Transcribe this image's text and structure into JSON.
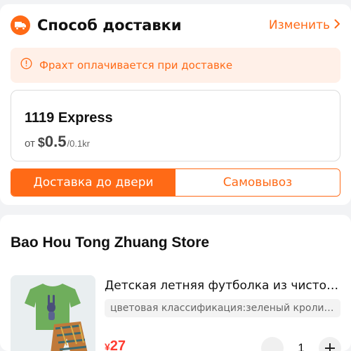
{
  "delivery": {
    "title": "Способ доставки",
    "change_label": "Изменить",
    "freight_notice": "Фрахт оплачивается при доставке",
    "shipping_option": {
      "carrier": "1119 Express",
      "price_prefix": "от",
      "currency": "$",
      "amount": "0.5",
      "unit": "/0.1kr"
    },
    "tabs": [
      {
        "label": "Доставка до двери",
        "active": true
      },
      {
        "label": "Самовывоз",
        "active": false
      }
    ]
  },
  "store": {
    "name": "Bao Hou Tong Zhuang Store",
    "product": {
      "title": "Детская летняя футболка из чистог...",
      "variant": "цветовая классификация:зеленый кролик...",
      "price_prefix": "¥",
      "price": "27",
      "quantity": "1"
    }
  },
  "icons": {
    "delivery": "truck-icon",
    "change": "chevron-right-icon",
    "notice": "info-circle-icon",
    "minus": "minus-icon",
    "plus": "plus-icon"
  },
  "colors": {
    "accent": "#ff6a16",
    "notice_bg": "#fff0e8",
    "price": "#ff3b30"
  }
}
